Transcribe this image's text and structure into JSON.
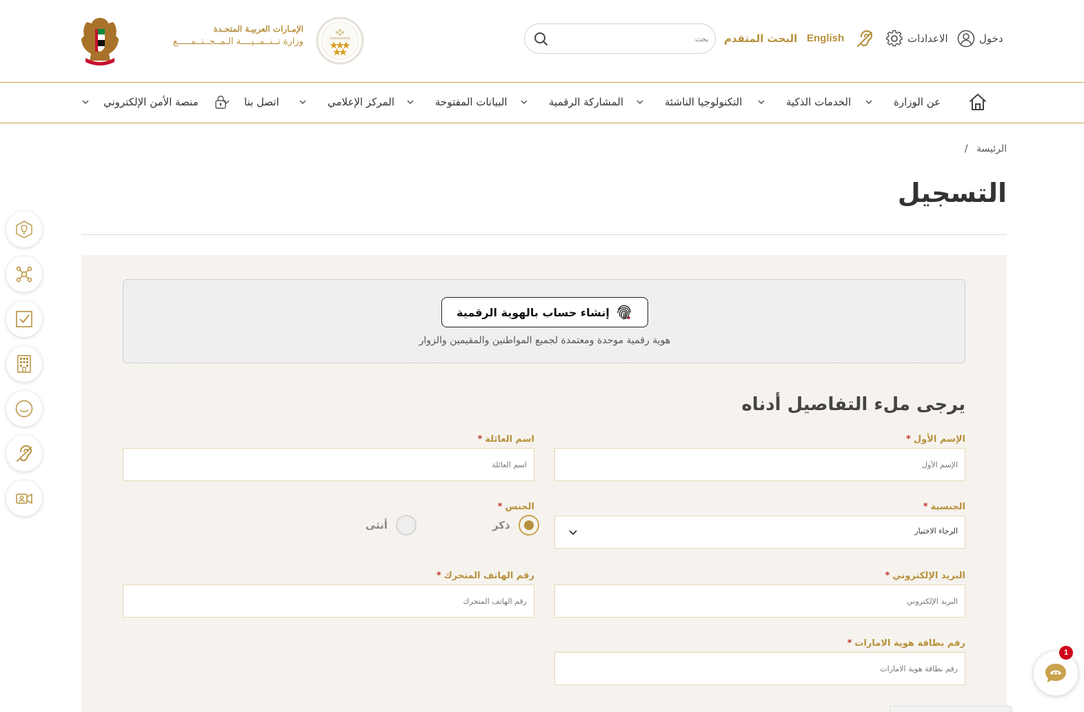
{
  "header": {
    "ministry_line1": "الإمـارات العربيـة المتحـدة",
    "ministry_line2": "وزارة تــنــمــيــــة الـمــجــتــمـــــع",
    "search_placeholder": "بحث",
    "advanced_search": "البحث المتقدم",
    "language": "English",
    "settings": "الاعدادات",
    "login": "دخول"
  },
  "nav": {
    "items": [
      {
        "label": "عن الوزارة"
      },
      {
        "label": "الخدمات الذكية"
      },
      {
        "label": "التكنولوجيا الناشئة"
      },
      {
        "label": "المشاركة الرقمية"
      },
      {
        "label": "البيانات المفتوحة"
      },
      {
        "label": "المركز الإعلامي"
      },
      {
        "label": "اتصل بنا"
      },
      {
        "label": "منصة الأمن الإلكتروني"
      }
    ]
  },
  "breadcrumb": {
    "home": "الرئيسة",
    "separator": "/"
  },
  "page": {
    "title": "التسجيل"
  },
  "uaepass": {
    "button_label": "إنشاء حساب بالهوية الرقمية",
    "note": "هوية رقمية موحدة ومعتمدة لجميع المواطنين والمقيمين والزوار"
  },
  "form": {
    "heading": "يرجى ملء التفاصيل أدناه",
    "required_mark": "*",
    "first_name": {
      "label": "الإسم الأول",
      "placeholder": "الإسم الأول"
    },
    "family_name": {
      "label": "اسم العائلة",
      "placeholder": "اسم العائلة"
    },
    "nationality": {
      "label": "الجنسية",
      "value": "الرجاء الاختيار"
    },
    "gender": {
      "label": "الجنس",
      "male": "ذكر",
      "female": "أنثى",
      "selected": "male"
    },
    "email": {
      "label": "البريد الإلكتروني",
      "placeholder": "البريد الإلكتروني"
    },
    "mobile": {
      "label": "رقم الهاتف المتحرك",
      "placeholder": "رقم الهاتف المتحرك"
    },
    "emirates_id": {
      "label": "رقم بطاقة هوية الامارات",
      "placeholder": "رقم بطاقة هوية الامارات"
    }
  },
  "chat": {
    "badge": "1"
  },
  "colors": {
    "accent": "#b8913d",
    "panel": "#f6f3ee",
    "required": "#c0392b",
    "badge": "#d0021b"
  },
  "icons": [
    "search-icon",
    "hearing-icon",
    "gear-icon",
    "user-icon",
    "home-icon",
    "chevron-down-icon",
    "lock-icon",
    "fingerprint-icon",
    "chat-icon"
  ]
}
